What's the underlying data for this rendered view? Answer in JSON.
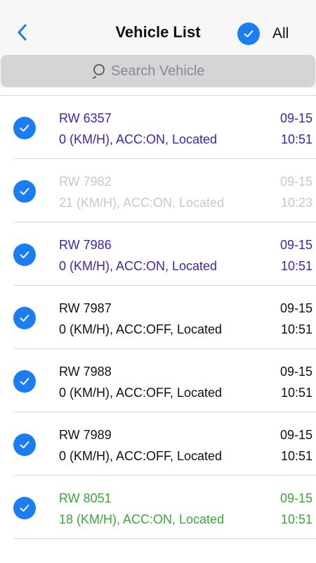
{
  "header": {
    "title": "Vehicle List",
    "all_label": "All"
  },
  "search": {
    "placeholder": "Search Vehicle"
  },
  "colors": {
    "accent": "#1a7df2",
    "moving": "#3aa63a",
    "idle_on": "#4422aa",
    "off": "#111111",
    "offline": "#c8c8c8"
  },
  "vehicles": [
    {
      "plate": "RW 6357",
      "status": "0 (KM/H), ACC:ON, Located",
      "date": "09-15",
      "time": "10:51",
      "color": "#4422aa",
      "checked": true
    },
    {
      "plate": "RW 7982",
      "status": "21 (KM/H), ACC:ON, Located",
      "date": "09-15",
      "time": "10:23",
      "color": "#c8c8c8",
      "checked": true
    },
    {
      "plate": "RW 7986",
      "status": "0 (KM/H), ACC:ON, Located",
      "date": "09-15",
      "time": "10:51",
      "color": "#4422aa",
      "checked": true
    },
    {
      "plate": "RW 7987",
      "status": "0 (KM/H), ACC:OFF, Located",
      "date": "09-15",
      "time": "10:51",
      "color": "#111111",
      "checked": true
    },
    {
      "plate": "RW 7988",
      "status": "0 (KM/H), ACC:OFF, Located",
      "date": "09-15",
      "time": "10:51",
      "color": "#111111",
      "checked": true
    },
    {
      "plate": "RW 7989",
      "status": "0 (KM/H), ACC:OFF, Located",
      "date": "09-15",
      "time": "10:51",
      "color": "#111111",
      "checked": true
    },
    {
      "plate": "RW 8051",
      "status": "18 (KM/H), ACC:ON, Located",
      "date": "09-15",
      "time": "10:51",
      "color": "#3aa63a",
      "checked": true
    }
  ]
}
